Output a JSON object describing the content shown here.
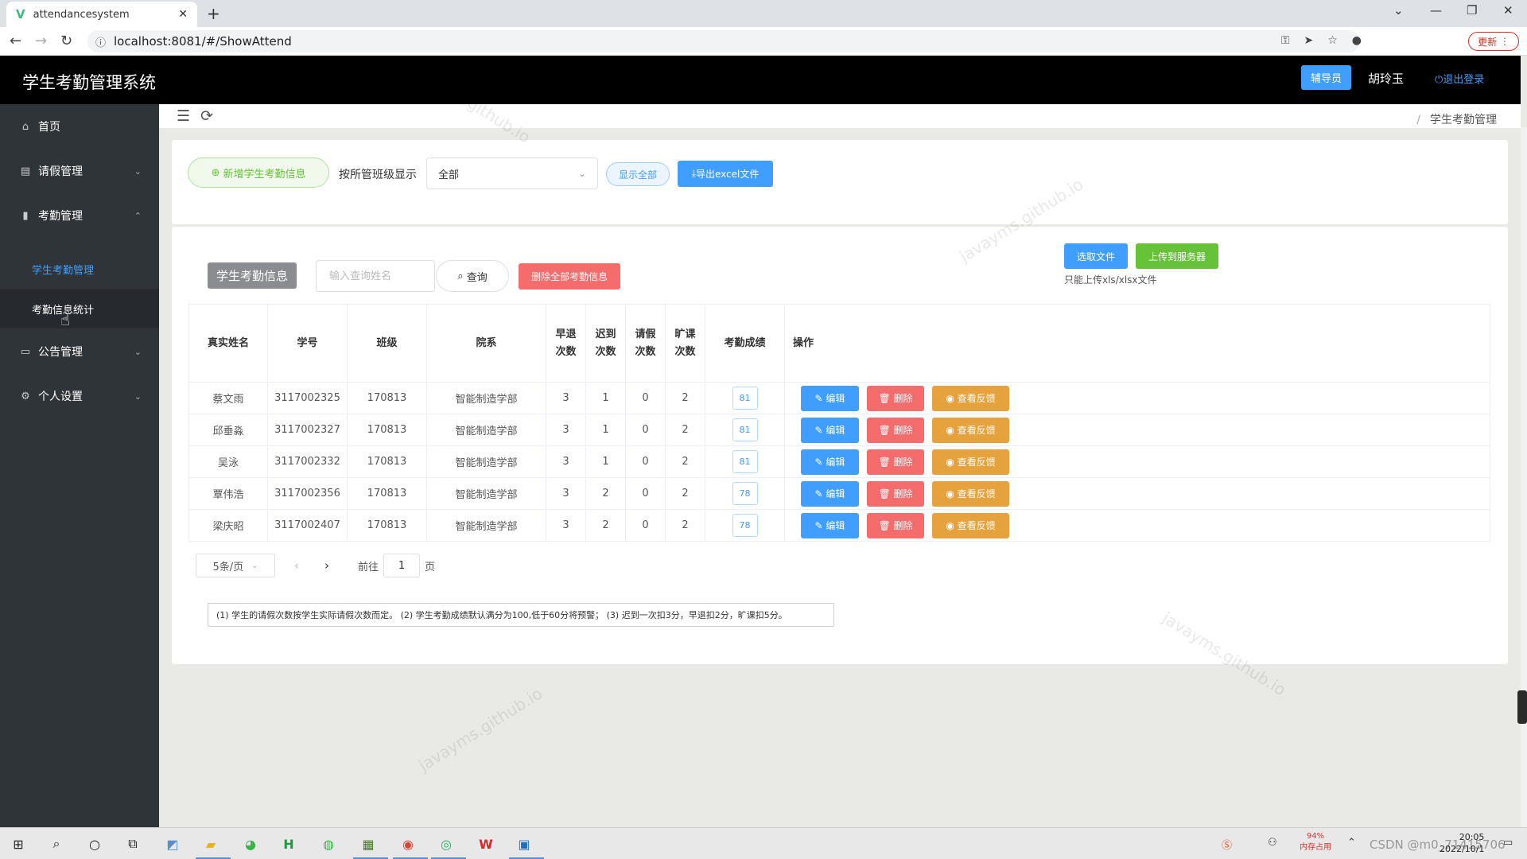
{
  "browser": {
    "tab_title": "attendancesystem",
    "url": "localhost:8081/#/ShowAttend",
    "update_label": "更新"
  },
  "header": {
    "app_title": "学生考勤管理系统",
    "role": "辅导员",
    "username": "胡玲玉",
    "logout": "退出登录"
  },
  "sidebar": {
    "home": "首页",
    "leave": "请假管理",
    "attendance": "考勤管理",
    "sub_student_attendance": "学生考勤管理",
    "sub_statistics": "考勤信息统计",
    "notice": "公告管理",
    "settings": "个人设置"
  },
  "breadcrumb": {
    "sep": "/",
    "current": "学生考勤管理"
  },
  "toolbar": {
    "add_label": "新增学生考勤信息",
    "class_filter_label": "按所管班级显示",
    "class_filter_value": "全部",
    "show_all_label": "显示全部",
    "export_label": "导出excel文件"
  },
  "panel": {
    "title": "学生考勤信息",
    "search_placeholder": "输入查询姓名",
    "query_label": "查询",
    "delete_all_label": "删除全部考勤信息",
    "select_file_label": "选取文件",
    "upload_label": "上传到服务器",
    "upload_tip": "只能上传xls/xlsx文件"
  },
  "table": {
    "headers": {
      "name": "真实姓名",
      "student_no": "学号",
      "class": "班级",
      "dept": "院系",
      "early_1": "早退",
      "early_2": "次数",
      "late_1": "迟到",
      "late_2": "次数",
      "leave_1": "请假",
      "leave_2": "次数",
      "absent_1": "旷课",
      "absent_2": "次数",
      "score": "考勤成绩",
      "ops": "操作"
    },
    "op_edit": "编辑",
    "op_delete": "删除",
    "op_view": "查看反馈",
    "rows": [
      {
        "name": "蔡文雨",
        "no": "3117002325",
        "class": "170813",
        "dept": "智能制造学部",
        "early": "3",
        "late": "1",
        "leave": "0",
        "absent": "2",
        "score": "81"
      },
      {
        "name": "邱垂淼",
        "no": "3117002327",
        "class": "170813",
        "dept": "智能制造学部",
        "early": "3",
        "late": "1",
        "leave": "0",
        "absent": "2",
        "score": "81"
      },
      {
        "name": "吴泳",
        "no": "3117002332",
        "class": "170813",
        "dept": "智能制造学部",
        "early": "3",
        "late": "1",
        "leave": "0",
        "absent": "2",
        "score": "81"
      },
      {
        "name": "覃伟浩",
        "no": "3117002356",
        "class": "170813",
        "dept": "智能制造学部",
        "early": "3",
        "late": "2",
        "leave": "0",
        "absent": "2",
        "score": "78"
      },
      {
        "name": "梁庆昭",
        "no": "3117002407",
        "class": "170813",
        "dept": "智能制造学部",
        "early": "3",
        "late": "2",
        "leave": "0",
        "absent": "2",
        "score": "78"
      }
    ]
  },
  "pagination": {
    "page_size": "5条/页",
    "goto_label": "前往",
    "current_page": "1",
    "page_unit": "页"
  },
  "note": "(1) 学生的请假次数按学生实际请假次数而定。 (2) 学生考勤成绩默认满分为100,低于60分将预警； (3) 迟到一次扣3分，早退扣2分，旷课扣5分。",
  "watermark": "javayms.github.io",
  "taskbar": {
    "mem_percent": "94%",
    "mem_label": "内存占用",
    "time": "20:05",
    "date": "2022/10/1",
    "csdn": "CSDN @m0_71415706"
  },
  "colors": {
    "primary": "#409eff",
    "success": "#67c23a",
    "danger": "#f56c6c",
    "warning": "#e6a23c",
    "sidebar_bg": "#2f3438"
  }
}
